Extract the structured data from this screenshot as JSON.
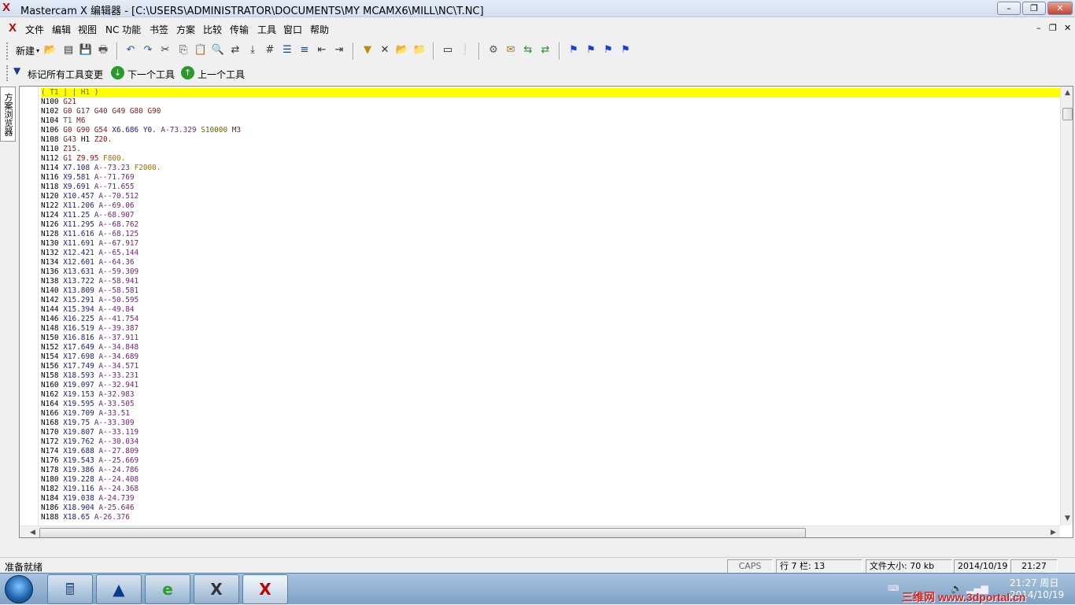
{
  "window": {
    "title": "Mastercam X 编辑器 - [C:\\USERS\\ADMINISTRATOR\\DOCUMENTS\\MY MCAMX6\\MILL\\NC\\T.NC]",
    "minimize": "–",
    "restore": "❐",
    "close": "✕"
  },
  "menu": {
    "items": [
      "文件",
      "编辑",
      "视图",
      "NC 功能",
      "书签",
      "方案",
      "比较",
      "传输",
      "工具",
      "窗口",
      "帮助"
    ],
    "mdi_minimize": "–",
    "mdi_restore": "❐",
    "mdi_close": "✕"
  },
  "toolbar1": {
    "new_label": "新建"
  },
  "toolbar2": {
    "mark_all_tool_changes": "标记所有工具变更",
    "next_tool": "下一个工具",
    "prev_tool": "上一个工具"
  },
  "side_tab": {
    "label": "方案浏览器"
  },
  "code_lines": [
    [
      [
        "cmt",
        "( T1 | | H1 )"
      ]
    ],
    [
      [
        "n",
        "N100 "
      ],
      [
        "g",
        "G21"
      ]
    ],
    [
      [
        "n",
        "N102 "
      ],
      [
        "g",
        "G0 G17 G40 G49 G80 G90"
      ]
    ],
    [
      [
        "n",
        "N104 "
      ],
      [
        "t",
        "T1 "
      ],
      [
        "m",
        "M6"
      ]
    ],
    [
      [
        "n",
        "N106 "
      ],
      [
        "g",
        "G0 G90 G54 "
      ],
      [
        "x",
        "X6.686 "
      ],
      [
        "y",
        "Y0. "
      ],
      [
        "a",
        "A-73.329 "
      ],
      [
        "s",
        "S10000 "
      ],
      [
        "m",
        "M3"
      ]
    ],
    [
      [
        "n",
        "N108 "
      ],
      [
        "g",
        "G43 "
      ],
      [
        "h",
        "H1 "
      ],
      [
        "z",
        "Z20."
      ]
    ],
    [
      [
        "n",
        "N110 "
      ],
      [
        "z",
        "Z15."
      ]
    ],
    [
      [
        "n",
        "N112 "
      ],
      [
        "g",
        "G1 "
      ],
      [
        "z",
        "Z9.95 "
      ],
      [
        "f",
        "F800."
      ]
    ],
    [
      [
        "n",
        "N114 "
      ],
      [
        "x",
        "X7.108 "
      ],
      [
        "a",
        "A--73.23 "
      ],
      [
        "f",
        "F2000."
      ]
    ],
    [
      [
        "n",
        "N116 "
      ],
      [
        "x",
        "X9.581 "
      ],
      [
        "a",
        "A--71.769"
      ]
    ],
    [
      [
        "n",
        "N118 "
      ],
      [
        "x",
        "X9.691 "
      ],
      [
        "a",
        "A--71.655"
      ]
    ],
    [
      [
        "n",
        "N120 "
      ],
      [
        "x",
        "X10.457 "
      ],
      [
        "a",
        "A--70.512"
      ]
    ],
    [
      [
        "n",
        "N122 "
      ],
      [
        "x",
        "X11.206 "
      ],
      [
        "a",
        "A--69.06"
      ]
    ],
    [
      [
        "n",
        "N124 "
      ],
      [
        "x",
        "X11.25 "
      ],
      [
        "a",
        "A--68.907"
      ]
    ],
    [
      [
        "n",
        "N126 "
      ],
      [
        "x",
        "X11.295 "
      ],
      [
        "a",
        "A--68.762"
      ]
    ],
    [
      [
        "n",
        "N128 "
      ],
      [
        "x",
        "X11.616 "
      ],
      [
        "a",
        "A--68.125"
      ]
    ],
    [
      [
        "n",
        "N130 "
      ],
      [
        "x",
        "X11.691 "
      ],
      [
        "a",
        "A--67.917"
      ]
    ],
    [
      [
        "n",
        "N132 "
      ],
      [
        "x",
        "X12.421 "
      ],
      [
        "a",
        "A--65.144"
      ]
    ],
    [
      [
        "n",
        "N134 "
      ],
      [
        "x",
        "X12.601 "
      ],
      [
        "a",
        "A--64.36"
      ]
    ],
    [
      [
        "n",
        "N136 "
      ],
      [
        "x",
        "X13.631 "
      ],
      [
        "a",
        "A--59.309"
      ]
    ],
    [
      [
        "n",
        "N138 "
      ],
      [
        "x",
        "X13.722 "
      ],
      [
        "a",
        "A--58.941"
      ]
    ],
    [
      [
        "n",
        "N140 "
      ],
      [
        "x",
        "X13.809 "
      ],
      [
        "a",
        "A--58.581"
      ]
    ],
    [
      [
        "n",
        "N142 "
      ],
      [
        "x",
        "X15.291 "
      ],
      [
        "a",
        "A--50.595"
      ]
    ],
    [
      [
        "n",
        "N144 "
      ],
      [
        "x",
        "X15.394 "
      ],
      [
        "a",
        "A--49.84"
      ]
    ],
    [
      [
        "n",
        "N146 "
      ],
      [
        "x",
        "X16.225 "
      ],
      [
        "a",
        "A--41.754"
      ]
    ],
    [
      [
        "n",
        "N148 "
      ],
      [
        "x",
        "X16.519 "
      ],
      [
        "a",
        "A--39.387"
      ]
    ],
    [
      [
        "n",
        "N150 "
      ],
      [
        "x",
        "X16.816 "
      ],
      [
        "a",
        "A--37.911"
      ]
    ],
    [
      [
        "n",
        "N152 "
      ],
      [
        "x",
        "X17.649 "
      ],
      [
        "a",
        "A--34.848"
      ]
    ],
    [
      [
        "n",
        "N154 "
      ],
      [
        "x",
        "X17.698 "
      ],
      [
        "a",
        "A--34.689"
      ]
    ],
    [
      [
        "n",
        "N156 "
      ],
      [
        "x",
        "X17.749 "
      ],
      [
        "a",
        "A--34.571"
      ]
    ],
    [
      [
        "n",
        "N158 "
      ],
      [
        "x",
        "X18.593 "
      ],
      [
        "a",
        "A--33.231"
      ]
    ],
    [
      [
        "n",
        "N160 "
      ],
      [
        "x",
        "X19.097 "
      ],
      [
        "a",
        "A--32.941"
      ]
    ],
    [
      [
        "n",
        "N162 "
      ],
      [
        "x",
        "X19.153 "
      ],
      [
        "a",
        "A-32.983"
      ]
    ],
    [
      [
        "n",
        "N164 "
      ],
      [
        "x",
        "X19.595 "
      ],
      [
        "a",
        "A-33.505"
      ]
    ],
    [
      [
        "n",
        "N166 "
      ],
      [
        "x",
        "X19.709 "
      ],
      [
        "a",
        "A-33.51"
      ]
    ],
    [
      [
        "n",
        "N168 "
      ],
      [
        "x",
        "X19.75 "
      ],
      [
        "a",
        "A--33.309"
      ]
    ],
    [
      [
        "n",
        "N170 "
      ],
      [
        "x",
        "X19.807 "
      ],
      [
        "a",
        "A--33.119"
      ]
    ],
    [
      [
        "n",
        "N172 "
      ],
      [
        "x",
        "X19.762 "
      ],
      [
        "a",
        "A--30.034"
      ]
    ],
    [
      [
        "n",
        "N174 "
      ],
      [
        "x",
        "X19.688 "
      ],
      [
        "a",
        "A--27.809"
      ]
    ],
    [
      [
        "n",
        "N176 "
      ],
      [
        "x",
        "X19.543 "
      ],
      [
        "a",
        "A--25.669"
      ]
    ],
    [
      [
        "n",
        "N178 "
      ],
      [
        "x",
        "X19.386 "
      ],
      [
        "a",
        "A--24.786"
      ]
    ],
    [
      [
        "n",
        "N180 "
      ],
      [
        "x",
        "X19.228 "
      ],
      [
        "a",
        "A--24.408"
      ]
    ],
    [
      [
        "n",
        "N182 "
      ],
      [
        "x",
        "X19.116 "
      ],
      [
        "a",
        "A--24.368"
      ]
    ],
    [
      [
        "n",
        "N184 "
      ],
      [
        "x",
        "X19.038 "
      ],
      [
        "a",
        "A-24.739"
      ]
    ],
    [
      [
        "n",
        "N186 "
      ],
      [
        "x",
        "X18.904 "
      ],
      [
        "a",
        "A-25.646"
      ]
    ],
    [
      [
        "n",
        "N188 "
      ],
      [
        "x",
        "X18.65 "
      ],
      [
        "a",
        "A-26.376"
      ]
    ]
  ],
  "status": {
    "ready": "准备就绪",
    "caps": "CAPS",
    "position": "行 7  栏: 13",
    "file_size": "文件大小: 70 kb",
    "date": "2014/10/19",
    "time": "21:27"
  },
  "taskbar": {
    "clock_time": "21:27 周日",
    "clock_date": "2014/10/19",
    "watermark": "三维网 www.3dportal.cn"
  },
  "colors": {
    "highlight": "#ffff00",
    "accent_red": "#c00000"
  }
}
